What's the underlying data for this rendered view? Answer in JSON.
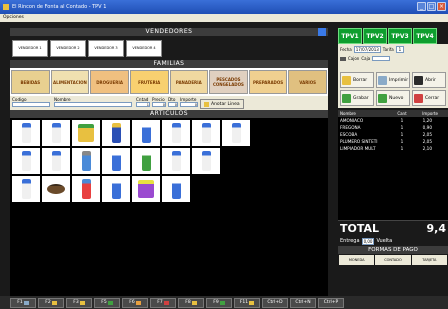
{
  "window": {
    "title": "El Rincon de Fonta al Contado - TPV 1"
  },
  "menu": {
    "options": "Opciones"
  },
  "sections": {
    "vendedores": "VENDEDORES",
    "familias": "FAMILIAS",
    "articulos": "ARTICULOS"
  },
  "vendedores": [
    "VENDEDOR 1",
    "VENDEDOR 2",
    "VENDEDOR 3",
    "VENDEDOR 4"
  ],
  "familias": [
    {
      "label": "BEBIDAS",
      "color": "#7a5a20"
    },
    {
      "label": "ALIMENTACION",
      "color": "#8a6a30"
    },
    {
      "label": "DROGUERIA",
      "color": "#b07020"
    },
    {
      "label": "FRUTERIA",
      "color": "#d09030"
    },
    {
      "label": "PANADERIA",
      "color": "#c08040"
    },
    {
      "label": "PESCADOS CONGELADOS",
      "color": "#8a7050"
    },
    {
      "label": "PREPARADOS",
      "color": "#b08040"
    },
    {
      "label": "VARIOS",
      "color": "#7a4a20"
    }
  ],
  "form": {
    "codigo": "Codigo",
    "nombre": "Nombre",
    "cantidad": "Cntad",
    "precio": "Precio",
    "dto": "Dto",
    "importe": "Importe",
    "cantidad_value": "1",
    "precio_value": "0",
    "dto_value": "0",
    "importe_value": "0",
    "anotar": "Anotar Linea"
  },
  "productos": [
    {
      "name": "bottle-white"
    },
    {
      "name": "bottle-white"
    },
    {
      "name": "box-green"
    },
    {
      "name": "can-blue"
    },
    {
      "name": "bottle-blue"
    },
    {
      "name": "bottle-white"
    },
    {
      "name": "bottle-white"
    },
    {
      "name": "bottle-white"
    },
    {
      "name": "bottle-white"
    },
    {
      "name": "bottle-white"
    },
    {
      "name": "mop"
    },
    {
      "name": "bottle-blue"
    },
    {
      "name": "bottle-green"
    },
    {
      "name": "bottle-white"
    },
    {
      "name": "bottle-white"
    },
    {
      "name": "empty"
    },
    {
      "name": "bottle-white"
    },
    {
      "name": "scourer"
    },
    {
      "name": "brush"
    },
    {
      "name": "bottle-blue"
    },
    {
      "name": "box-purple"
    },
    {
      "name": "bottle-blue"
    },
    {
      "name": "empty"
    },
    {
      "name": "empty"
    }
  ],
  "tpvs": [
    "TPV1",
    "TPV2",
    "TPV3",
    "TPV4"
  ],
  "fecha": {
    "label": "Fecha",
    "value": "17/07/2013",
    "tarifa_label": "Tarifa",
    "tarifa_value": "1",
    "cajon_label": "Cajon",
    "caja_label": "Caja"
  },
  "actions": [
    {
      "label": "Borrar",
      "color": "#e8c040"
    },
    {
      "label": "Imprimir",
      "color": "#8aaac8"
    },
    {
      "label": "Abrir",
      "color": "#2a2a2a"
    },
    {
      "label": "Grabar",
      "color": "#40a040"
    },
    {
      "label": "Nuevo",
      "color": "#40a040"
    },
    {
      "label": "Cerrar",
      "color": "#d04040"
    }
  ],
  "lines": {
    "headers": [
      "Nombre",
      "Cant",
      "Importe"
    ],
    "rows": [
      {
        "nombre": "AMONIACO",
        "cant": "1",
        "importe": "1,20"
      },
      {
        "nombre": "FREGONA",
        "cant": "1",
        "importe": "0,90"
      },
      {
        "nombre": "ESCOBA",
        "cant": "1",
        "importe": "2,05"
      },
      {
        "nombre": "PLUMERO SINTETI",
        "cant": "1",
        "importe": "2,05"
      },
      {
        "nombre": "LIMPIADOR MULT",
        "cant": "1",
        "importe": "2,10"
      }
    ]
  },
  "total": {
    "label": "TOTAL",
    "value": "9,4"
  },
  "entrega": {
    "label": "Entrega",
    "value": "0,00",
    "vuelta_label": "Vuelta"
  },
  "formas": "FORMAS DE PAGO",
  "pagos": [
    "MONEDA",
    "CONTADO",
    "TARJETA"
  ],
  "fkeys": [
    "F1",
    "F2",
    "F3",
    "F5",
    "F6",
    "F7",
    "F8",
    "F9",
    "F11",
    "Ctrl+D",
    "Ctrl+N",
    "Ctrl+P"
  ]
}
